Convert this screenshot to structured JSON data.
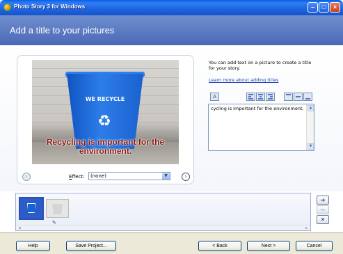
{
  "window": {
    "title": "Photo Story 3 for Windows"
  },
  "header": {
    "title": "Add a title to your pictures"
  },
  "preview": {
    "bin_text": "WE RECYCLE",
    "caption": "Recycling is important for the environment.",
    "effect_label": "Effect:",
    "effect_value": "(none)"
  },
  "panel": {
    "instructions": "You can add text on a picture to create a title for your story.",
    "learn_link": "Learn more about adding titles",
    "text_value": "cycling is important for the environment."
  },
  "filmstrip": {
    "items": [
      "thumbnail-recycle-bin",
      "thumbnail-empty-bin"
    ]
  },
  "buttons": {
    "help": "Help",
    "save_project": "Save Project...",
    "back": "< Back",
    "next": "Next >",
    "cancel": "Cancel"
  },
  "icons": [
    "app-icon",
    "minimize-icon",
    "maximize-icon",
    "close-icon",
    "font-icon",
    "align-left-icon",
    "align-center-icon",
    "align-right-icon",
    "valign-top-icon",
    "valign-middle-icon",
    "valign-bottom-icon",
    "prev-arrow-icon",
    "next-arrow-icon",
    "edit-icon",
    "move-right-icon",
    "move-left-icon",
    "delete-icon"
  ],
  "colors": {
    "titlebar": "#1e63e0",
    "header": "#5a78c0",
    "caption": "#8b1a10",
    "bin": "#1a61cf"
  }
}
